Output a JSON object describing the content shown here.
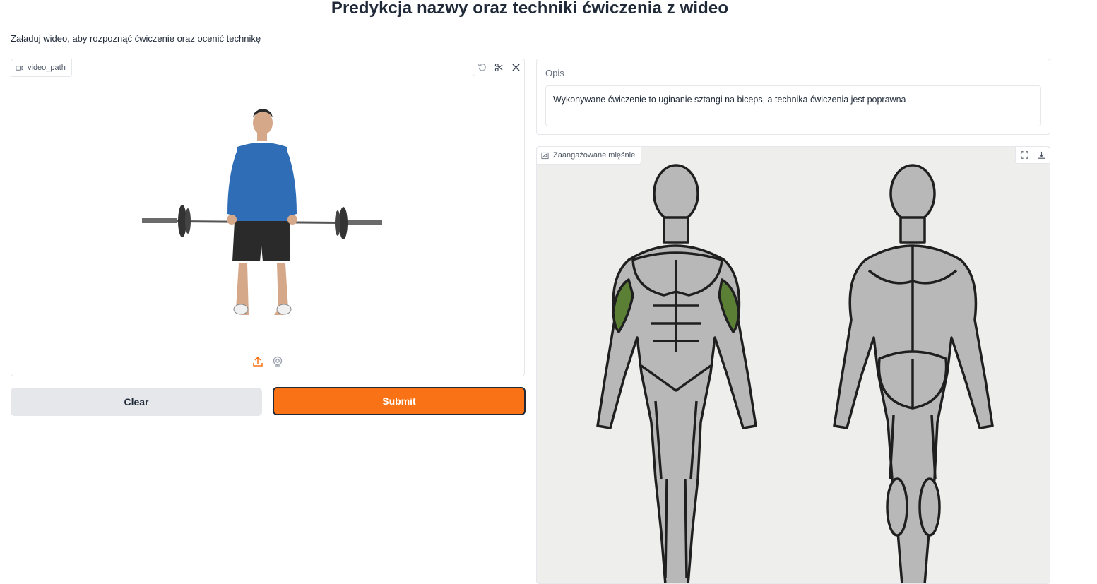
{
  "page": {
    "title": "Predykcja nazwy oraz techniki ćwiczenia z wideo",
    "subtitle": "Załaduj wideo, aby rozpoznąć ćwiczenie oraz ocenić technikę"
  },
  "video_input": {
    "label": "video_path",
    "icons": [
      "video-icon",
      "undo-icon",
      "scissors-icon",
      "close-icon",
      "upload-icon",
      "webcam-icon"
    ]
  },
  "buttons": {
    "clear": "Clear",
    "submit": "Submit"
  },
  "output": {
    "label": "Opis",
    "value": "Wykonywane ćwiczenie to uginanie sztangi na biceps, a technika ćwiczenia jest poprawna"
  },
  "image_output": {
    "label": "Zaangażowane mięśnie",
    "icons": [
      "image-icon",
      "fullscreen-icon",
      "download-icon"
    ]
  },
  "colors": {
    "accent": "#f97316",
    "highlight_muscle": "#5a7f35",
    "muscle_gray": "#b8b8b8"
  }
}
